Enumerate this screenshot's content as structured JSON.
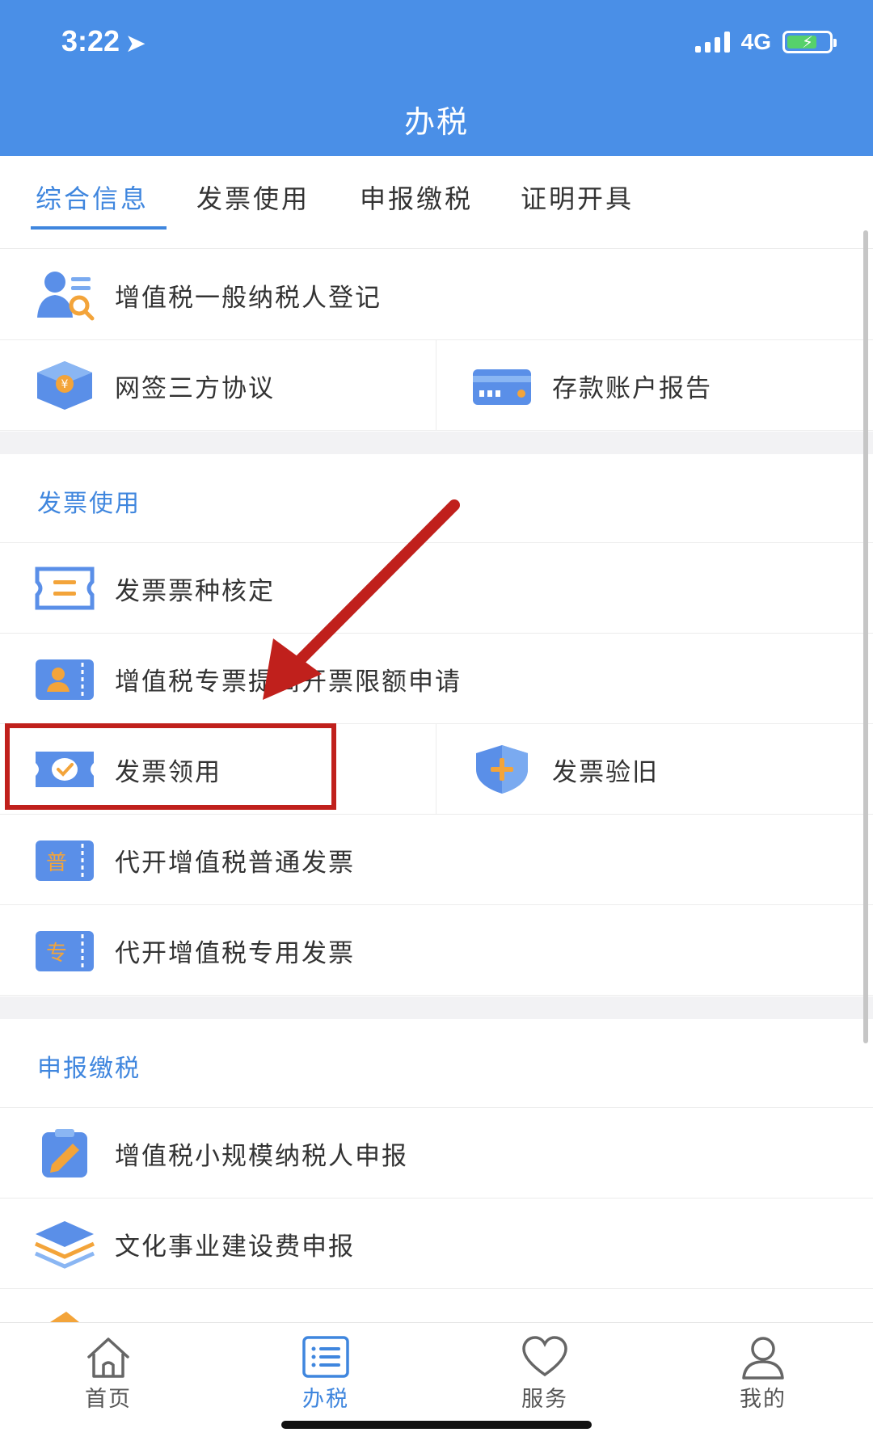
{
  "status": {
    "time": "3:22",
    "network": "4G"
  },
  "header": {
    "title": "办税"
  },
  "tabs": [
    "综合信息",
    "发票使用",
    "申报缴税",
    "证明开具"
  ],
  "items": {
    "vat_general_registration": "增值税一般纳税人登记",
    "tripartite_agreement": "网签三方协议",
    "deposit_account_report": "存款账户报告",
    "invoice_type_approval": "发票票种核定",
    "vat_special_limit_increase": "增值税专票提高开票限额申请",
    "invoice_collection": "发票领用",
    "invoice_verification": "发票验旧",
    "agent_vat_ordinary": "代开增值税普通发票",
    "agent_vat_special": "代开增值税专用发票",
    "small_scale_vat_declaration": "增值税小规模纳税人申报",
    "cultural_fee_declaration": "文化事业建设费申报"
  },
  "sections": {
    "invoice_use": "发票使用",
    "declare_pay": "申报缴税"
  },
  "icon_glyphs": {
    "puhu": "普",
    "zhuan": "专",
    "yuan": "¥"
  },
  "tabbar": {
    "home": "首页",
    "tax": "办税",
    "service": "服务",
    "mine": "我的"
  },
  "colors": {
    "brand": "#4a8fe7",
    "accent": "#3f86de",
    "highlight": "#c0201c"
  }
}
